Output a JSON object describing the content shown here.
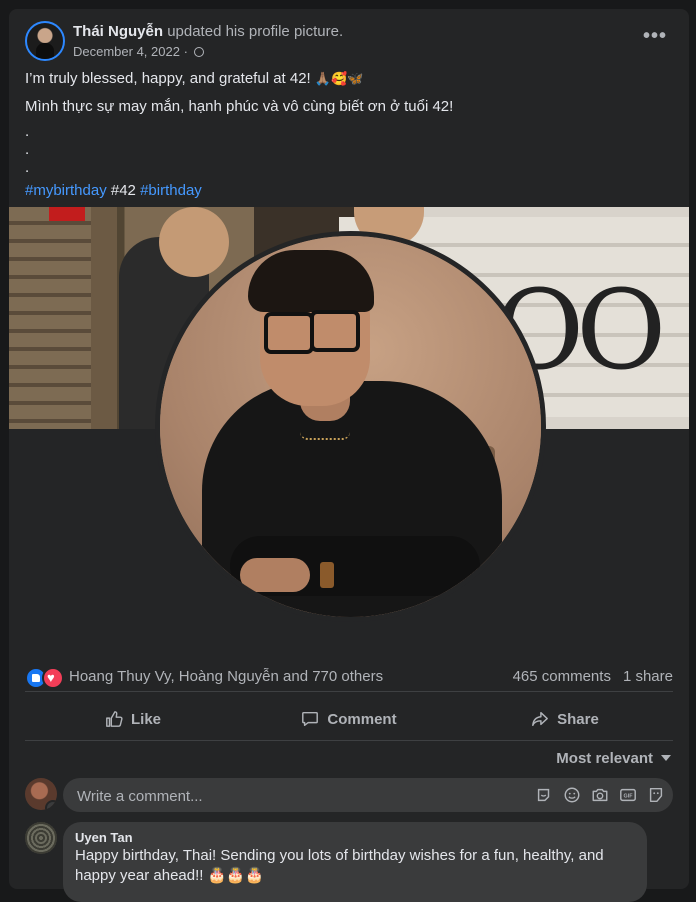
{
  "post": {
    "author": "Thái Nguyễn",
    "action": "updated his profile picture.",
    "date": "December 4, 2022",
    "date_separator": "·",
    "privacy_icon": "globe-icon",
    "more_label": "•••",
    "lines": [
      "I’m truly blessed, happy, and grateful at 42!",
      "Mình thực sự may mắn, hạnh phúc và vô cùng biết ơn ở tuổi 42!",
      ".",
      ".",
      "."
    ],
    "emojis": "🙏🏽🥰🦋",
    "hashtags": [
      "#mybirthday",
      "#42",
      "#birthday"
    ],
    "cover_text": "OO"
  },
  "reactions": {
    "icons": [
      "like-icon",
      "love-icon"
    ],
    "names": "Hoang Thuy Vy, Hoàng Nguyễn and 770 others",
    "comments": "465 comments",
    "shares": "1 share"
  },
  "actions": {
    "like": "Like",
    "comment": "Comment",
    "share": "Share"
  },
  "sort": {
    "label": "Most relevant"
  },
  "composer": {
    "placeholder": "Write a comment...",
    "icons": [
      "avatar-sticker-icon",
      "emoji-icon",
      "camera-icon",
      "gif-icon",
      "sticker-icon"
    ]
  },
  "comment": {
    "name": "Uyen Tan",
    "text": "Happy birthday, Thai! Sending you lots of birthday wishes for a fun, healthy, and happy year ahead!! 🎂🎂🎂"
  },
  "colors": {
    "background": "#18191a",
    "card": "#242526",
    "hashtag": "#4599ff",
    "secondary_text": "#b0b3b8",
    "like_blue": "#1877f2",
    "love_red": "#f33e58"
  }
}
